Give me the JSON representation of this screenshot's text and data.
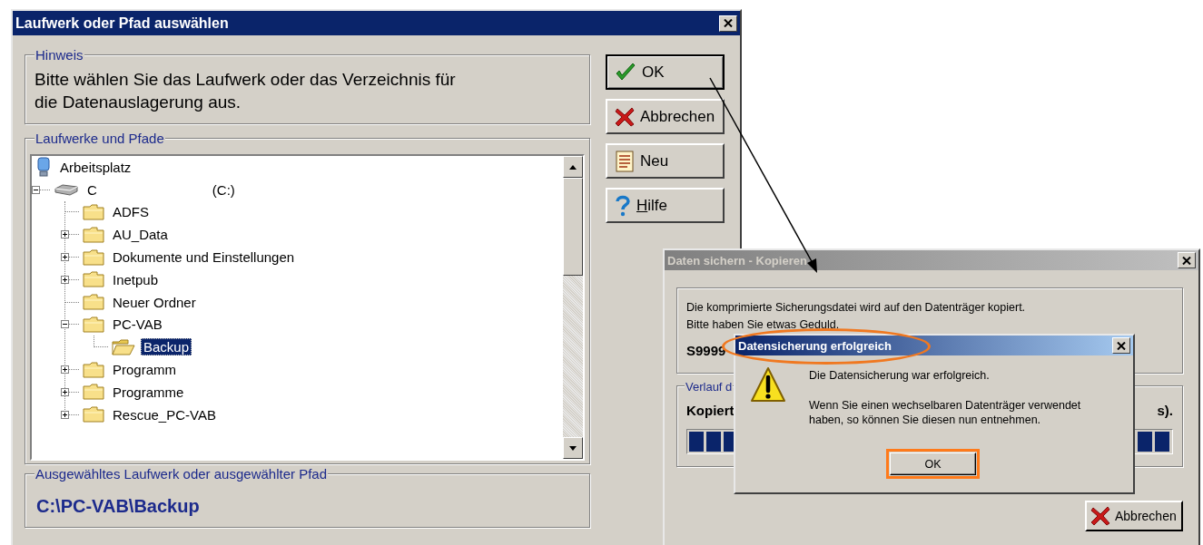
{
  "path_dialog": {
    "title": "Laufwerk oder Pfad auswählen",
    "active": true,
    "hint_group": {
      "label": "Hinweis",
      "lines": [
        "Bitte wählen Sie das Laufwerk oder das Verzeichnis für",
        "die Datenauslagerung aus."
      ]
    },
    "tree_group": {
      "label": "Laufwerke und Pfade",
      "tree": [
        {
          "label": "Arbeitsplatz",
          "kind": "computer",
          "selected": false,
          "children": [
            {
              "label": "C",
              "drive_letter": "(C:)",
              "kind": "drive",
              "expanded": true,
              "selected": false,
              "children": [
                {
                  "label": "ADFS",
                  "kind": "folder",
                  "selected": false
                },
                {
                  "label": "AU_Data",
                  "kind": "folder",
                  "expanded": false,
                  "selected": false
                },
                {
                  "label": "Dokumente und Einstellungen",
                  "kind": "folder",
                  "expanded": false,
                  "selected": false
                },
                {
                  "label": "Inetpub",
                  "kind": "folder",
                  "expanded": false,
                  "selected": false
                },
                {
                  "label": "Neuer Ordner",
                  "kind": "folder",
                  "selected": false
                },
                {
                  "label": "PC-VAB",
                  "kind": "folder",
                  "expanded": true,
                  "selected": false,
                  "children": [
                    {
                      "label": "Backup",
                      "kind": "folder",
                      "selected": true
                    }
                  ]
                },
                {
                  "label": "Programm",
                  "kind": "folder",
                  "expanded": false,
                  "selected": false
                },
                {
                  "label": "Programme",
                  "kind": "folder",
                  "expanded": false,
                  "selected": false
                },
                {
                  "label": "Rescue_PC-VAB",
                  "kind": "folder",
                  "expanded": false,
                  "selected": false
                }
              ]
            }
          ]
        }
      ]
    },
    "selected_path_group": {
      "label": "Ausgewähltes Laufwerk oder ausgewählter Pfad",
      "value": "C:\\PC-VAB\\Backup"
    },
    "buttons": [
      {
        "label": "OK",
        "kind": "ok",
        "mnemonic": false
      },
      {
        "label": "Abbrechen",
        "kind": "cancel",
        "mnemonic": false
      },
      {
        "label": "Neu",
        "kind": "new",
        "mnemonic": false
      },
      {
        "label": "Hilfe",
        "kind": "help",
        "mnemonic": true
      }
    ]
  },
  "copy_dialog": {
    "title": "Daten sichern - Kopieren",
    "active": false,
    "message_lines": [
      "Die komprimierte Sicherungsdatei wird auf den Datenträger kopiert.",
      "Bitte haben Sie etwas Geduld."
    ],
    "file_name": "S9999",
    "progress_group": {
      "label": "Verlauf d",
      "status_left": "Kopiert",
      "status_right": "s).",
      "level": 1
    },
    "cancel_button": "Abbrechen"
  },
  "success_dialog": {
    "title": "Datensicherung erfolgreich",
    "active": true,
    "title_highlighted": true,
    "message": "Die Datensicherung war erfolgreich.",
    "detail_lines": [
      "Wenn Sie einen wechselbaren Datenträger verwendet",
      "haben, so können Sie diesen nun entnehmen."
    ],
    "ok_button": "OK",
    "ok_highlighted": true
  }
}
